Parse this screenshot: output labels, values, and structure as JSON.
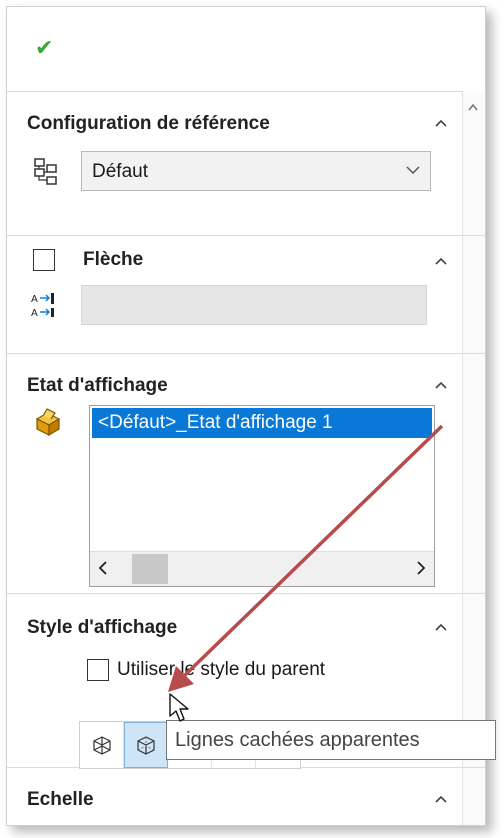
{
  "ok_button": {
    "icon": "check-icon",
    "color": "#39a53a"
  },
  "sections": {
    "ref_config": {
      "title": "Configuration de référence",
      "value": "Défaut"
    },
    "arrow": {
      "title": "Flèche",
      "checked": false,
      "field_value": ""
    },
    "display_state": {
      "title": "Etat d'affichage",
      "items": [
        "<Défaut>_Etat d'affichage 1"
      ]
    },
    "display_style": {
      "title": "Style d'affichage",
      "use_parent_label": "Utiliser le style du parent",
      "selected_index": 1,
      "buttons": [
        "wireframe-icon",
        "hidden-lines-visible-icon",
        "hidden-lines-removed-icon",
        "shaded-with-edges-icon",
        "shaded-icon"
      ]
    },
    "scale": {
      "title": "Echelle"
    }
  },
  "tooltip": "Lignes cachées apparentes",
  "colors": {
    "selection": "#0a78d7",
    "annotation_arrow": "#b84b4b"
  }
}
